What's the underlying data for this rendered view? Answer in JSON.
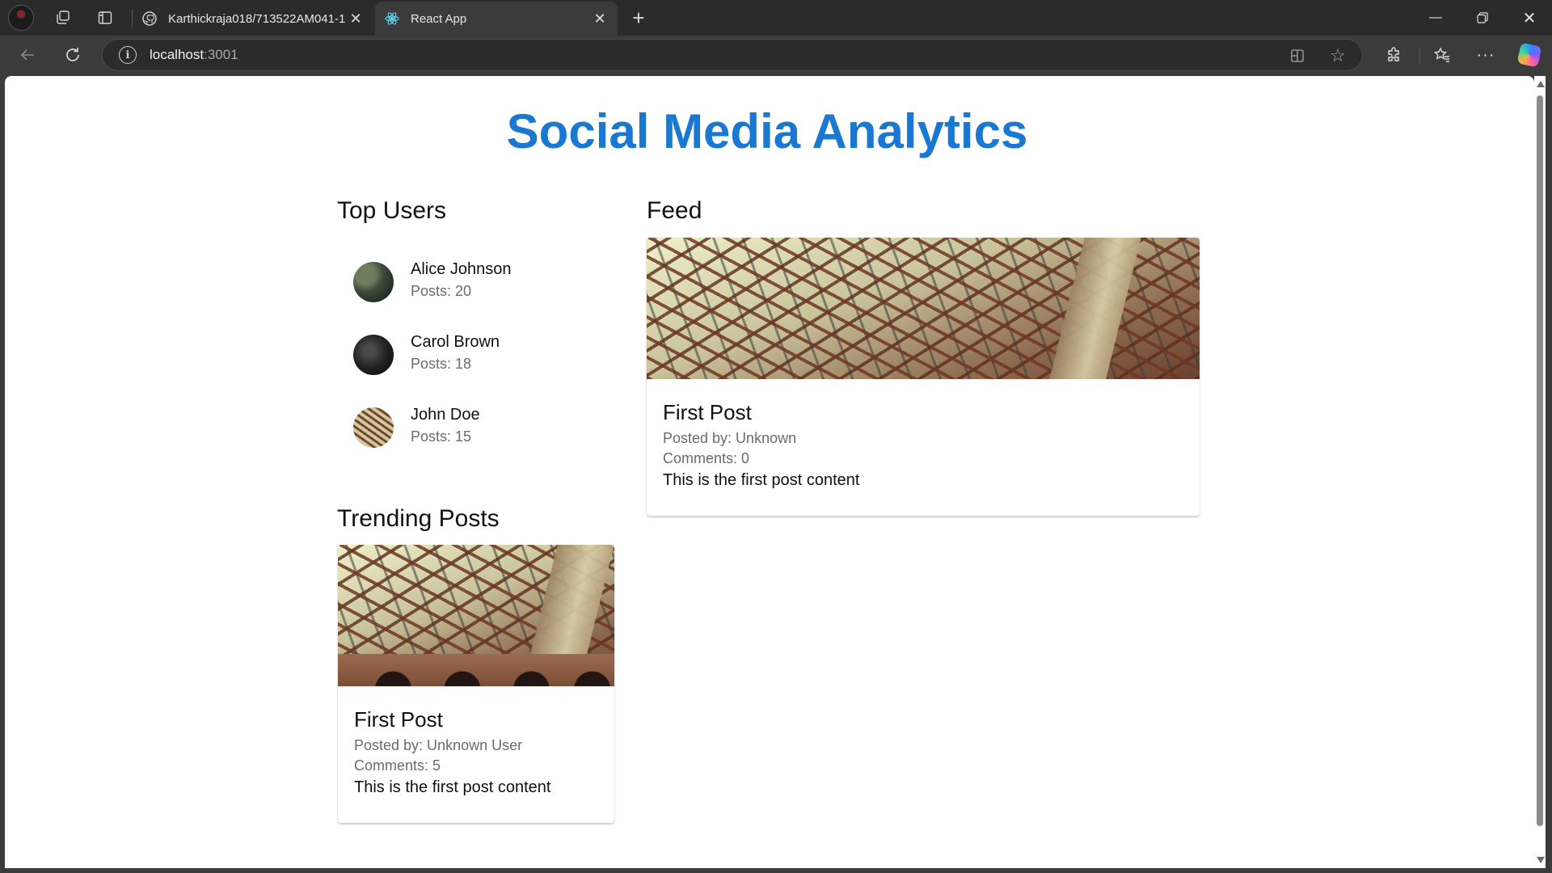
{
  "browser": {
    "tabs": [
      {
        "title": "Karthickraja018/713522AM041-1",
        "icon": "github-icon"
      },
      {
        "title": "React App",
        "icon": "react-icon",
        "active": true
      }
    ],
    "address": {
      "host": "localhost",
      "port": ":3001"
    }
  },
  "app": {
    "title": "Social Media Analytics",
    "accent_color": "#1a78d2"
  },
  "top_users": {
    "heading": "Top Users",
    "users": [
      {
        "name": "Alice Johnson",
        "posts": "Posts: 20"
      },
      {
        "name": "Carol Brown",
        "posts": "Posts: 18"
      },
      {
        "name": "John Doe",
        "posts": "Posts: 15"
      }
    ]
  },
  "feed": {
    "heading": "Feed",
    "post": {
      "title": "First Post",
      "posted_by": "Posted by: Unknown",
      "comments": "Comments: 0",
      "content": "This is the first post content"
    }
  },
  "trending": {
    "heading": "Trending Posts",
    "post": {
      "title": "First Post",
      "posted_by": "Posted by: Unknown User",
      "comments": "Comments: 5",
      "content": "This is the first post content"
    }
  }
}
